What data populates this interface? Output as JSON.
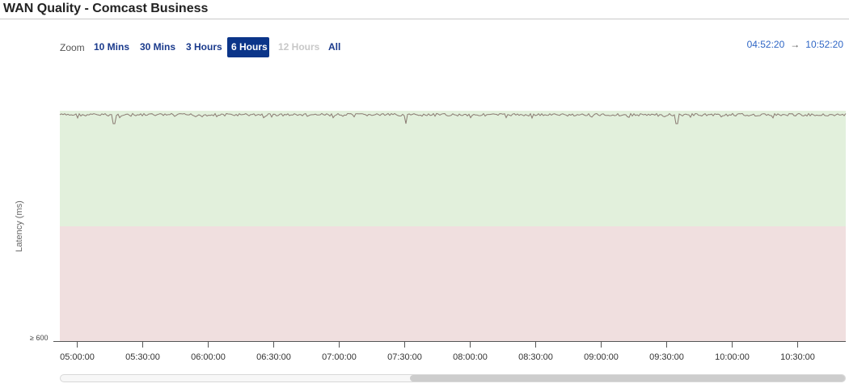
{
  "header": {
    "title": "WAN Quality - Comcast Business"
  },
  "zoom": {
    "label": "Zoom",
    "buttons": [
      {
        "label": "10 Mins",
        "state": "normal"
      },
      {
        "label": "30 Mins",
        "state": "normal"
      },
      {
        "label": "3 Hours",
        "state": "normal"
      },
      {
        "label": "6 Hours",
        "state": "active"
      },
      {
        "label": "12 Hours",
        "state": "disabled"
      },
      {
        "label": "All",
        "state": "normal"
      }
    ]
  },
  "range": {
    "from": "04:52:20",
    "arrow": "→",
    "to": "10:52:20"
  },
  "colors": {
    "good_band": "#e2f0dc",
    "bad_band": "#f0dfdf",
    "latency_line": "#8a7a72",
    "accent": "#0b3589"
  },
  "chart_data": {
    "type": "line",
    "ylabel": "Latency (ms)",
    "y_tick_label": "≥ 600",
    "x_ticks": [
      "05:00:00",
      "05:30:00",
      "06:00:00",
      "06:30:00",
      "07:00:00",
      "07:30:00",
      "08:00:00",
      "08:30:00",
      "09:00:00",
      "09:30:00",
      "10:00:00",
      "10:30:00"
    ],
    "x_range": [
      "04:52:20",
      "10:52:20"
    ],
    "series": [
      {
        "spikes": [
          "05:17:00",
          "07:31:00",
          "09:35:00"
        ],
        "baseline_level": "near top of green band, low latency"
      }
    ],
    "bands": [
      "good (green, upper half)",
      "poor (red, lower half)"
    ]
  },
  "scrollbar": {
    "thumb_start": 0.445,
    "thumb_end": 1.0
  }
}
